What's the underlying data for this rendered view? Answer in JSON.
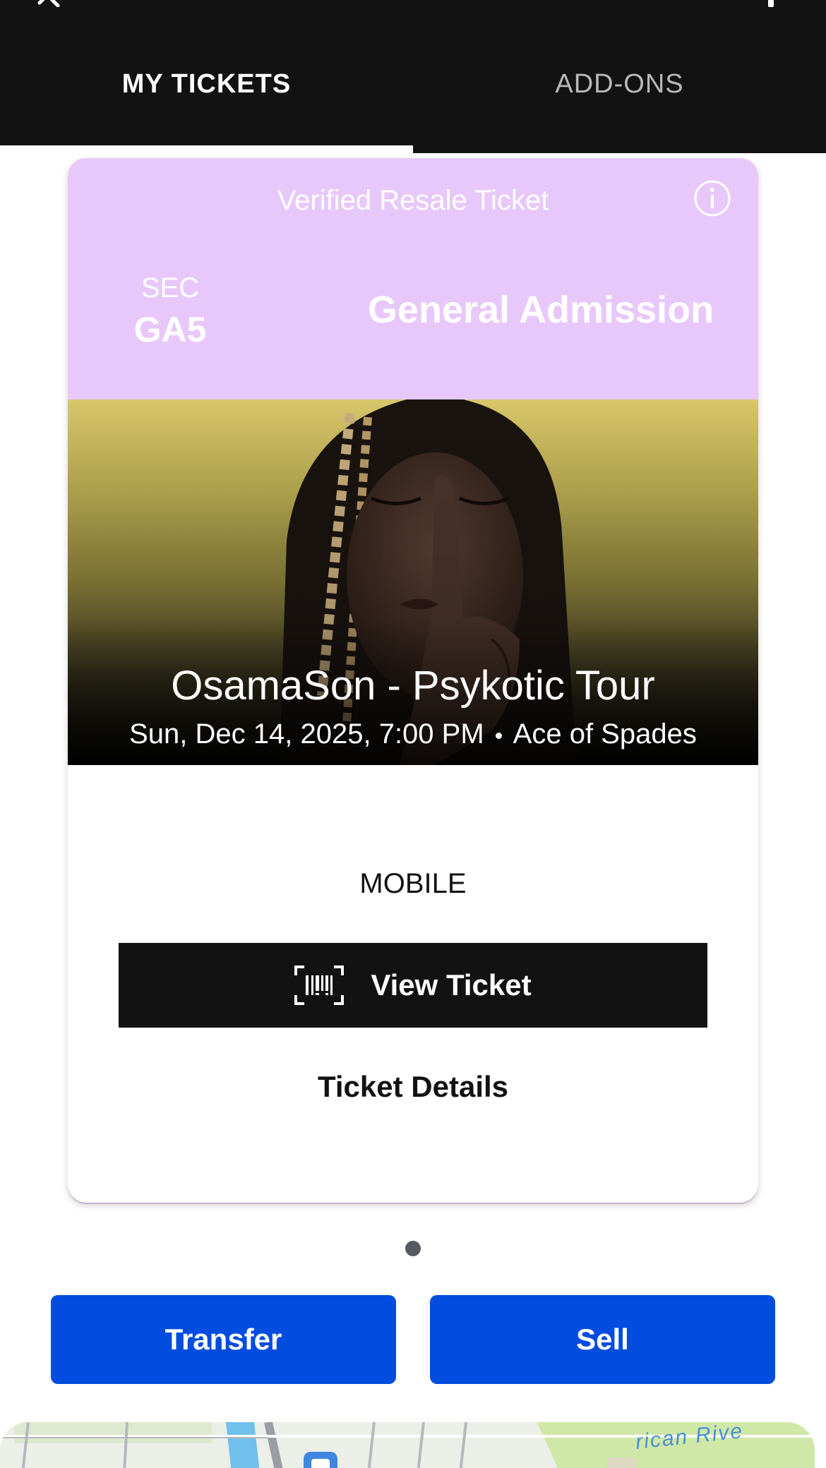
{
  "header": {
    "tabs": [
      {
        "label": "MY TICKETS",
        "active": true
      },
      {
        "label": "ADD-ONS",
        "active": false
      }
    ]
  },
  "ticket": {
    "resale_label": "Verified Resale Ticket",
    "section_label": "SEC",
    "section_value": "GA5",
    "admission": "General Admission",
    "event_title": "OsamaSon - Psykotic Tour",
    "event_datetime": "Sun, Dec 14, 2025, 7:00 PM",
    "event_venue": "Ace of Spades",
    "delivery_type": "MOBILE",
    "view_ticket_label": "View Ticket",
    "ticket_details_label": "Ticket Details",
    "head_color": "#e8c8fa"
  },
  "pager": {
    "count": 1,
    "current": 1
  },
  "actions": {
    "transfer_label": "Transfer",
    "sell_label": "Sell",
    "accent_color": "#024ddf"
  },
  "map": {
    "river_label": "rican Rive"
  },
  "icons": {
    "close": "close-icon",
    "info": "info-icon",
    "barcode": "barcode-icon",
    "transit": "transit-icon"
  }
}
